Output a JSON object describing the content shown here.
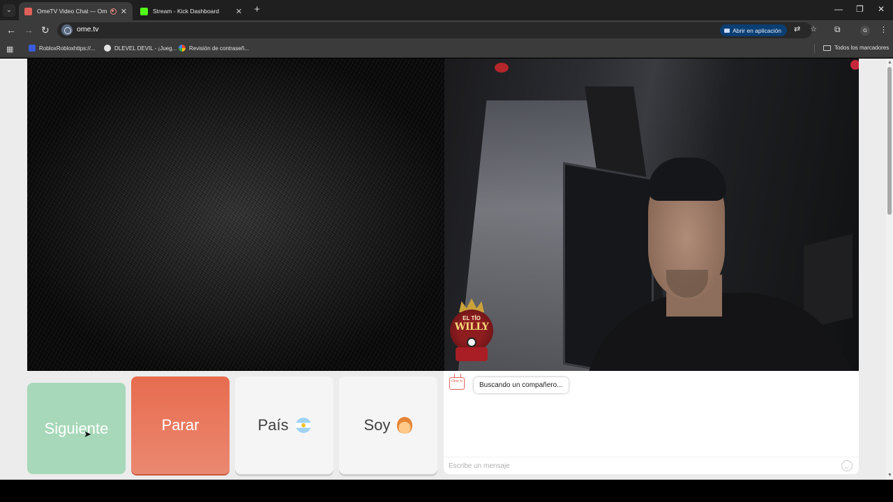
{
  "browser": {
    "tabs": [
      {
        "title": "OmeTV Video Chat — Omegl",
        "active": true,
        "favicon_color": "#e0615a"
      },
      {
        "title": "Stream - Kick Dashboard",
        "active": false,
        "favicon_color": "#53fc18"
      }
    ],
    "url": "ome.tv",
    "open_app_label": "Abrir en aplicación",
    "profile_initial": "G",
    "bookmarks": [
      {
        "label": "RobloxRobloxhttps://...",
        "icon_color": "#3b5bdb"
      },
      {
        "label": "DLEVEL DEVIL - ¡Jueg...",
        "icon_color": "#e3e3e3"
      },
      {
        "label": "Revisión de contraseñ...",
        "icon_color": "#4285f4"
      }
    ],
    "all_bookmarks_label": "Todos los marcadores"
  },
  "overlay": {
    "logo_line1": "EL TÍO",
    "logo_line2": "WILLY"
  },
  "controls": {
    "next_label": "Siguiente",
    "stop_label": "Parar",
    "country_label": "País",
    "gender_label": "Soy"
  },
  "chat": {
    "logo_text": "Ome tv",
    "status_message": "Buscando un compañero...",
    "input_placeholder": "Escribe un mensaje"
  }
}
